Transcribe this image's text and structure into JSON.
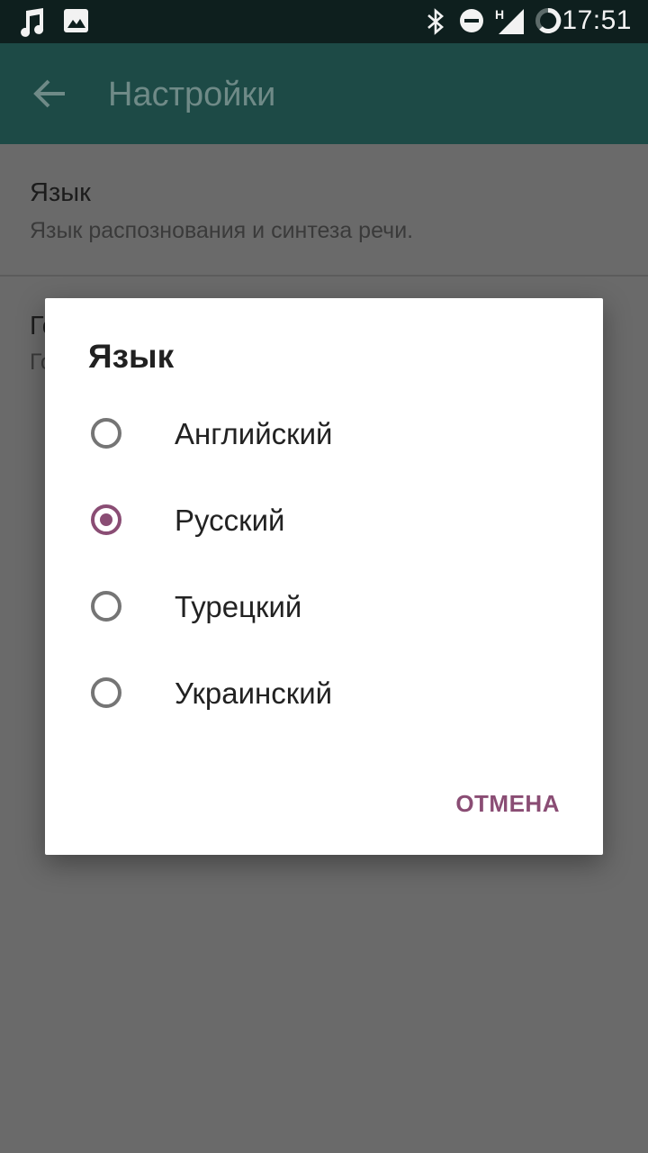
{
  "status_bar": {
    "time": "17:51",
    "network_letter": "H",
    "icons": [
      "music-note-icon",
      "image-icon",
      "bluetooth-icon",
      "do-not-disturb-icon",
      "signal-icon",
      "battery-icon"
    ]
  },
  "toolbar": {
    "title": "Настройки",
    "back_icon": "arrow-back-icon"
  },
  "preferences": [
    {
      "title": "Язык",
      "summary": "Язык распознования и синтеза речи."
    },
    {
      "title": "Го",
      "summary": "Го"
    }
  ],
  "dialog": {
    "title": "Язык",
    "options": [
      {
        "label": "Английский",
        "selected": false
      },
      {
        "label": "Русский",
        "selected": true
      },
      {
        "label": "Турецкий",
        "selected": false
      },
      {
        "label": "Украинский",
        "selected": false
      }
    ],
    "cancel_label": "ОТМЕНА"
  },
  "colors": {
    "accent": "#8a4d74",
    "toolbar": "#1d4a46",
    "statusbar": "#0e1f1e",
    "scrim": "#6a6a6a"
  }
}
